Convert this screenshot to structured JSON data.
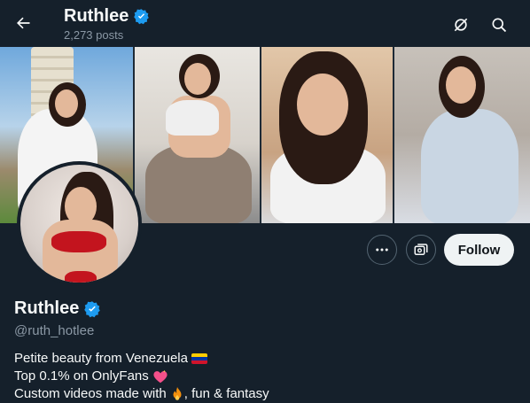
{
  "header": {
    "name": "Ruthlee",
    "posts": "2,273 posts"
  },
  "profile": {
    "name": "Ruthlee",
    "handle": "@ruth_hotlee",
    "follow_label": "Follow"
  },
  "bio": {
    "line1": "Petite beauty from Venezuela",
    "line2": "Top 0.1% on OnlyFans",
    "line3_before": "Custom videos made with",
    "line3_after": ", fun & fantasy"
  },
  "icons": {
    "back": "arrow-left-icon",
    "notifications": "notifications-off-icon",
    "search": "search-icon",
    "verified": "verified-badge-icon",
    "more": "more-icon",
    "subscribe": "subscribe-icon"
  },
  "colors": {
    "background": "#15202b",
    "verified": "#1d9bf0",
    "secondary_text": "#8b98a5",
    "follow_button": "#eff3f4"
  }
}
